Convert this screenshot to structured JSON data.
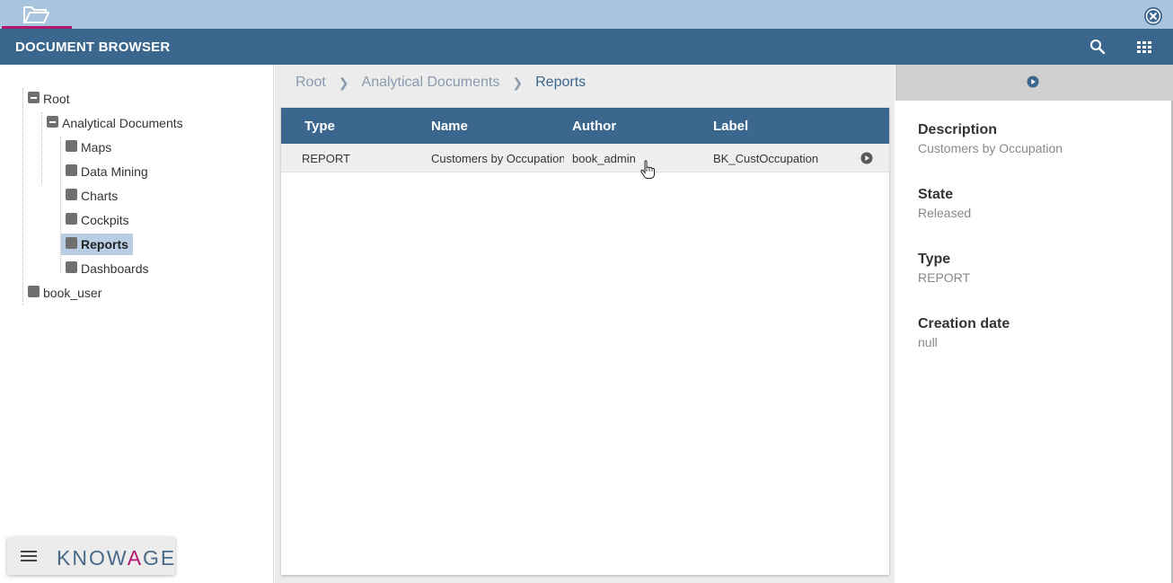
{
  "header": {
    "title": "DOCUMENT BROWSER"
  },
  "icons": {
    "tab": "folder-open-icon",
    "close": "close-circle-icon",
    "search": "search-icon",
    "view": "grid-view-icon",
    "menu": "hamburger-menu-icon",
    "run": "play-circle-icon"
  },
  "colors": {
    "header": "#3b678f",
    "tab_strip": "#a9c4de",
    "accent": "#b0186e",
    "selected": "#b9cde4"
  },
  "tree": {
    "root": "Root",
    "analytical": "Analytical Documents",
    "children": [
      "Maps",
      "Data Mining",
      "Charts",
      "Cockpits",
      "Reports",
      "Dashboards"
    ],
    "selected": "Reports",
    "user": "book_user"
  },
  "breadcrumb": [
    "Root",
    "Analytical Documents",
    "Reports"
  ],
  "table": {
    "columns": [
      "Type",
      "Name",
      "Author",
      "Label"
    ],
    "rows": [
      [
        "REPORT",
        "Customers by Occupation",
        "book_admin",
        "BK_CustOccupation"
      ]
    ]
  },
  "detail": {
    "fields": [
      {
        "key": "Description",
        "value": "Customers by Occupation"
      },
      {
        "key": "State",
        "value": "Released"
      },
      {
        "key": "Type",
        "value": "REPORT"
      },
      {
        "key": "Creation date",
        "value": "null"
      }
    ]
  },
  "branding": {
    "logo_main": "KNOW",
    "logo_accent": "A",
    "logo_end": "GE"
  }
}
